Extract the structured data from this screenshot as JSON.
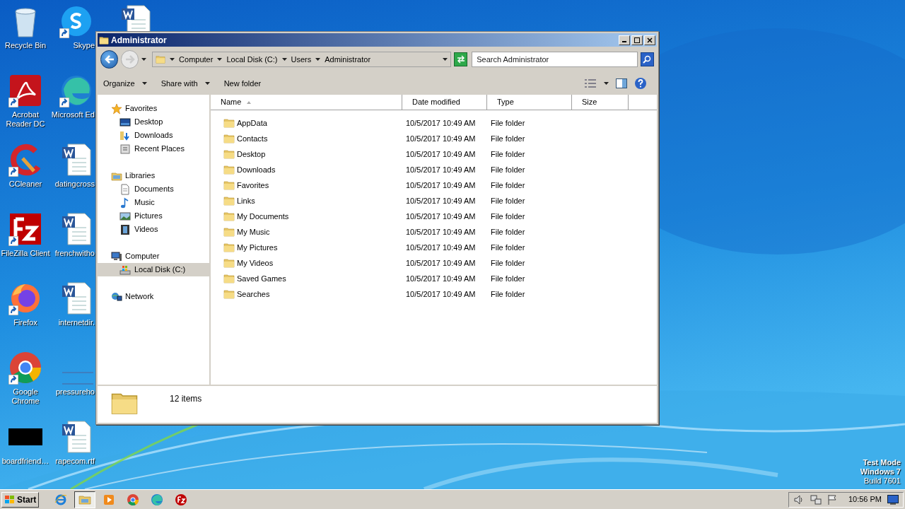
{
  "desktop_icons": [
    {
      "label": "Recycle Bin",
      "kind": "recycle"
    },
    {
      "label": "Skype",
      "kind": "skype"
    },
    {
      "kind": "word"
    },
    {
      "label": "Acrobat Reader DC",
      "kind": "acrobat"
    },
    {
      "label": "Microsoft Ed",
      "kind": "edge"
    },
    {
      "label": "CCleaner",
      "kind": "ccleaner"
    },
    {
      "label": "datingcross",
      "kind": "word"
    },
    {
      "label": "FileZilla Client",
      "kind": "filezilla"
    },
    {
      "label": "frenchwitho",
      "kind": "word"
    },
    {
      "label": "Firefox",
      "kind": "firefox"
    },
    {
      "label": "internetdir.",
      "kind": "word"
    },
    {
      "label": "Google Chrome",
      "kind": "chrome"
    },
    {
      "label": "pressureho",
      "kind": "blank"
    },
    {
      "label": "boardfriend…",
      "kind": "black"
    },
    {
      "label": "rapecom.rtf",
      "kind": "word"
    }
  ],
  "window": {
    "title": "Administrator",
    "address": [
      "Computer",
      "Local Disk (C:)",
      "Users",
      "Administrator"
    ],
    "search": {
      "placeholder": "Search Administrator"
    },
    "toolbar": [
      {
        "label": "Organize",
        "dropdown": true
      },
      {
        "label": "Share with",
        "dropdown": true
      },
      {
        "label": "New folder",
        "dropdown": false
      }
    ],
    "nav": [
      {
        "label": "Favorites",
        "kind": "star",
        "selected": false,
        "children": [
          {
            "label": "Desktop",
            "kind": "desktop",
            "selected": false
          },
          {
            "label": "Downloads",
            "kind": "downloads",
            "selected": false
          },
          {
            "label": "Recent Places",
            "kind": "recent",
            "selected": false
          }
        ]
      },
      {
        "label": "Libraries",
        "kind": "libraries",
        "selected": false,
        "children": [
          {
            "label": "Documents",
            "kind": "documents",
            "selected": false
          },
          {
            "label": "Music",
            "kind": "music",
            "selected": false
          },
          {
            "label": "Pictures",
            "kind": "pictures",
            "selected": false
          },
          {
            "label": "Videos",
            "kind": "videos",
            "selected": false
          }
        ]
      },
      {
        "label": "Computer",
        "kind": "computer",
        "selected": false,
        "children": [
          {
            "label": "Local Disk (C:)",
            "kind": "disk",
            "selected": true
          }
        ]
      },
      {
        "label": "Network",
        "kind": "network",
        "selected": false
      }
    ],
    "columns": [
      "Name",
      "Date modified",
      "Type",
      "Size"
    ],
    "rows": [
      {
        "name": "AppData",
        "date": "10/5/2017 10:49 AM",
        "type": "File folder"
      },
      {
        "name": "Contacts",
        "date": "10/5/2017 10:49 AM",
        "type": "File folder"
      },
      {
        "name": "Desktop",
        "date": "10/5/2017 10:49 AM",
        "type": "File folder"
      },
      {
        "name": "Downloads",
        "date": "10/5/2017 10:49 AM",
        "type": "File folder"
      },
      {
        "name": "Favorites",
        "date": "10/5/2017 10:49 AM",
        "type": "File folder"
      },
      {
        "name": "Links",
        "date": "10/5/2017 10:49 AM",
        "type": "File folder"
      },
      {
        "name": "My Documents",
        "date": "10/5/2017 10:49 AM",
        "type": "File folder"
      },
      {
        "name": "My Music",
        "date": "10/5/2017 10:49 AM",
        "type": "File folder"
      },
      {
        "name": "My Pictures",
        "date": "10/5/2017 10:49 AM",
        "type": "File folder"
      },
      {
        "name": "My Videos",
        "date": "10/5/2017 10:49 AM",
        "type": "File folder"
      },
      {
        "name": "Saved Games",
        "date": "10/5/2017 10:49 AM",
        "type": "File folder"
      },
      {
        "name": "Searches",
        "date": "10/5/2017 10:49 AM",
        "type": "File folder"
      }
    ],
    "status": "12 items"
  },
  "system_notice": [
    "Test Mode",
    "Windows 7",
    "Build 7601"
  ],
  "taskbar": {
    "start": "Start",
    "apps": [
      {
        "kind": "ie",
        "selected": false
      },
      {
        "kind": "explorer",
        "selected": true
      },
      {
        "kind": "media",
        "selected": false
      },
      {
        "kind": "chrome",
        "selected": false
      },
      {
        "kind": "edge",
        "selected": false
      },
      {
        "kind": "filezilla",
        "selected": false
      }
    ],
    "time": "10:56 PM"
  }
}
